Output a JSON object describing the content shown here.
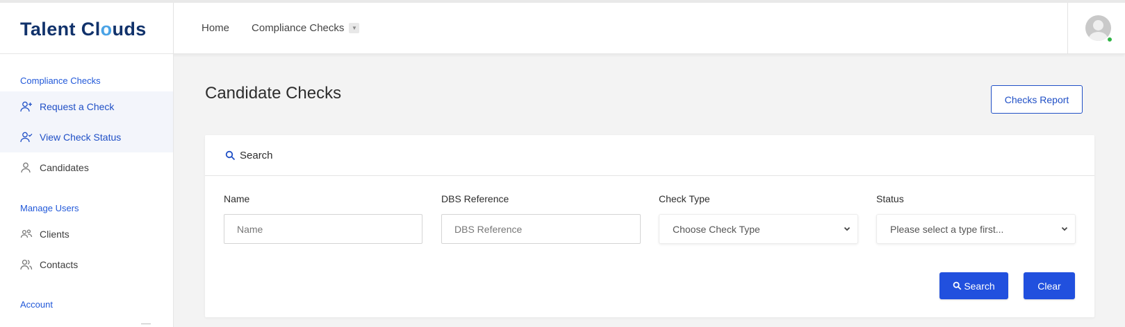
{
  "brand": {
    "name_part1": "Talent Cl",
    "name_o": "o",
    "name_part2": "uds"
  },
  "nav": {
    "home": "Home",
    "compliance": "Compliance Checks"
  },
  "sidebar": {
    "sections": {
      "compliance": "Compliance Checks",
      "manage_users": "Manage Users",
      "account": "Account"
    },
    "items": [
      {
        "label": "Request a Check",
        "icon": "user-plus-icon"
      },
      {
        "label": "View Check Status",
        "icon": "user-check-icon"
      },
      {
        "label": "Candidates",
        "icon": "user-icon"
      },
      {
        "label": "Clients",
        "icon": "users-icon"
      },
      {
        "label": "Contacts",
        "icon": "contacts-icon"
      }
    ]
  },
  "main": {
    "title": "Candidate Checks",
    "report_button": "Checks Report",
    "search_card": {
      "title": "Search",
      "fields": {
        "name_label": "Name",
        "name_placeholder": "Name",
        "dbs_label": "DBS Reference",
        "dbs_placeholder": "DBS Reference",
        "check_type_label": "Check Type",
        "check_type_value": "Choose Check Type",
        "status_label": "Status",
        "status_value": "Please select a type first..."
      },
      "search_button": "Search",
      "clear_button": "Clear"
    }
  },
  "colors": {
    "primary": "#2150de",
    "brand": "#11326b",
    "accent": "#4aa3e6",
    "online": "#2fb344"
  }
}
